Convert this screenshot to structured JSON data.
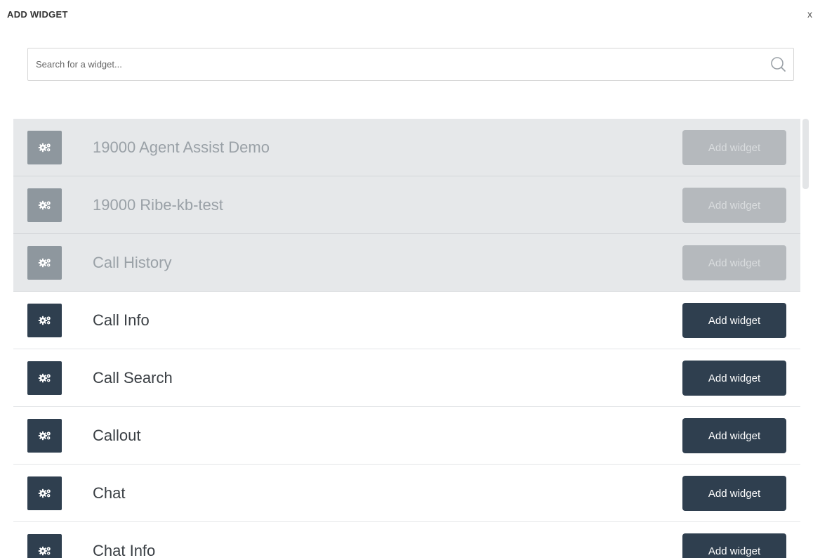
{
  "dialog": {
    "title": "ADD WIDGET",
    "close_label": "x"
  },
  "search": {
    "placeholder": "Search for a widget...",
    "value": "",
    "icon": "search-icon"
  },
  "widgets": [
    {
      "name": "19000 Agent Assist Demo",
      "button": "Add widget",
      "disabled": true,
      "icon": "gears-icon"
    },
    {
      "name": "19000 Ribe-kb-test",
      "button": "Add widget",
      "disabled": true,
      "icon": "gears-icon"
    },
    {
      "name": "Call History",
      "button": "Add widget",
      "disabled": true,
      "icon": "gears-icon"
    },
    {
      "name": "Call Info",
      "button": "Add widget",
      "disabled": false,
      "icon": "gears-icon"
    },
    {
      "name": "Call Search",
      "button": "Add widget",
      "disabled": false,
      "icon": "gears-icon"
    },
    {
      "name": "Callout",
      "button": "Add widget",
      "disabled": false,
      "icon": "gears-icon"
    },
    {
      "name": "Chat",
      "button": "Add widget",
      "disabled": false,
      "icon": "gears-icon"
    },
    {
      "name": "Chat Info",
      "button": "Add widget",
      "disabled": false,
      "icon": "gears-icon"
    }
  ],
  "colors": {
    "primary": "#2f3f4f",
    "disabled_row_bg": "#e6e8ea",
    "disabled_button": "#b5b9bd",
    "disabled_icon": "#8e979e"
  }
}
